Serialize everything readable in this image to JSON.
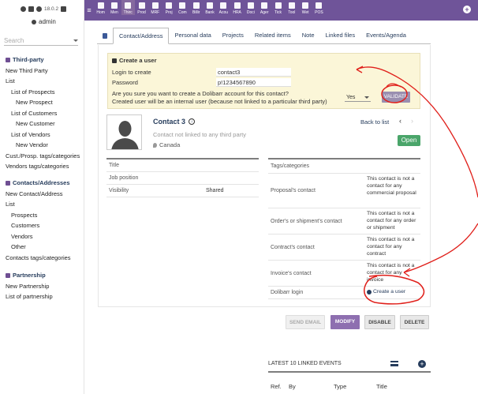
{
  "app": {
    "version": "18.0.2",
    "username": "admin"
  },
  "search": {
    "placeholder": "Search"
  },
  "sidebar": {
    "third_party": {
      "title": "Third-party",
      "items": [
        "New Third Party",
        "List",
        "List of Prospects",
        "New Prospect",
        "List of Customers",
        "New Customer",
        "List of Vendors",
        "New Vendor",
        "Cust./Prosp. tags/categories",
        "Vendors tags/categories"
      ]
    },
    "contacts": {
      "title": "Contacts/Addresses",
      "items": [
        "New Contact/Address",
        "List",
        "Prospects",
        "Customers",
        "Vendors",
        "Other",
        "Contacts tags/categories"
      ]
    },
    "partnership": {
      "title": "Partnership",
      "items": [
        "New Partnership",
        "List of partnership"
      ]
    }
  },
  "topmenu": [
    "Hom",
    "Men",
    "Thirc",
    "Prod",
    "MRF",
    "Proj",
    "Com",
    "Billir",
    "Bank",
    "Acou",
    "HRA",
    "Doci",
    "Ager",
    "Tick",
    "Tool",
    "Wet",
    "POS"
  ],
  "tabs": [
    "Contact/Address",
    "Personal data",
    "Projects",
    "Related items",
    "Note",
    "Linked files",
    "Events/Agenda"
  ],
  "confirm": {
    "title": "Create a user",
    "login_label": "Login to create",
    "login_value": "contact3",
    "password_label": "Password",
    "password_value": "p!1234567890",
    "question": "Are you sure you want to create a Dolibarr account for this contact?",
    "note": "Created user will be an internal user (because not linked to a particular third party)",
    "select_value": "Yes",
    "validate_label": "VALIDATE"
  },
  "contact": {
    "name": "Contact 3",
    "not_linked": "Contact not linked to any third party",
    "country": "Canada",
    "back_label": "Back to list",
    "open_label": "Open"
  },
  "left_fields": [
    {
      "k": "Title",
      "v": ""
    },
    {
      "k": "Job position",
      "v": ""
    },
    {
      "k": "Visibility",
      "v": "Shared"
    }
  ],
  "right_fields": [
    {
      "k": "Tags/categories",
      "v": ""
    },
    {
      "k": "Proposal's contact",
      "v": "This contact is not a contact for any commercial proposal"
    },
    {
      "k": "Order's or shipment's contact",
      "v": "This contact is not a contact for any order or shipment"
    },
    {
      "k": "Contract's contact",
      "v": "This contact is not a contact for any contract"
    },
    {
      "k": "Invoice's contact",
      "v": "This contact is not a contact for any invoice"
    },
    {
      "k": "Dolibarr login",
      "v": "Create a user"
    }
  ],
  "buttons": {
    "send_email": "SEND EMAIL",
    "modify": "MODIFY",
    "disable": "DISABLE",
    "delete": "DELETE"
  },
  "events": {
    "title": "LATEST 10 LINKED EVENTS",
    "cols": [
      "Ref.",
      "By",
      "Type",
      "Title"
    ]
  }
}
